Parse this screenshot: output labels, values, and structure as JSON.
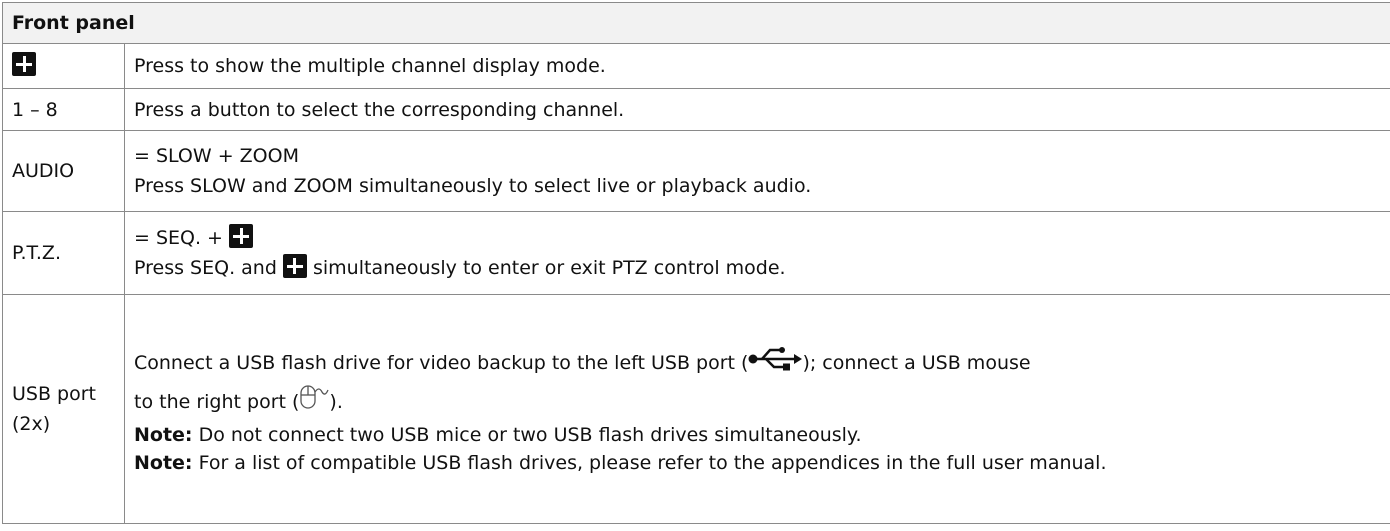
{
  "header": {
    "title": "Front panel"
  },
  "rows": [
    {
      "key_icon": "grid-icon",
      "desc": "Press to show the multiple channel display mode."
    },
    {
      "key": "1 – 8",
      "desc": "Press a button to select the corresponding channel."
    },
    {
      "key": "AUDIO",
      "desc_line1": "= SLOW + ZOOM",
      "desc_line2": "Press SLOW and ZOOM simultaneously to select live or playback audio."
    },
    {
      "key": "P.T.Z.",
      "desc_line1_prefix": "= SEQ. +",
      "desc_line2_prefix": "Press SEQ. and",
      "desc_line2_suffix": "simultaneously to enter or exit PTZ control mode.",
      "icon": "grid-icon"
    },
    {
      "key_line1": "USB port",
      "key_line2": "(2x)",
      "desc_part1": "Connect a USB flash drive for video backup to the left USB port (",
      "desc_part2": "); connect a USB mouse",
      "desc_part3": "to the right port (",
      "desc_part4": ").",
      "usb_icon": "usb-icon",
      "mouse_icon": "mouse-icon",
      "note1_label": "Note:",
      "note1_text": "Do not connect two USB mice or two USB flash drives simultaneously.",
      "note2_label": "Note:",
      "note2_text": "For a list of compatible USB flash drives, please refer to the appendices in the full user manual."
    }
  ]
}
